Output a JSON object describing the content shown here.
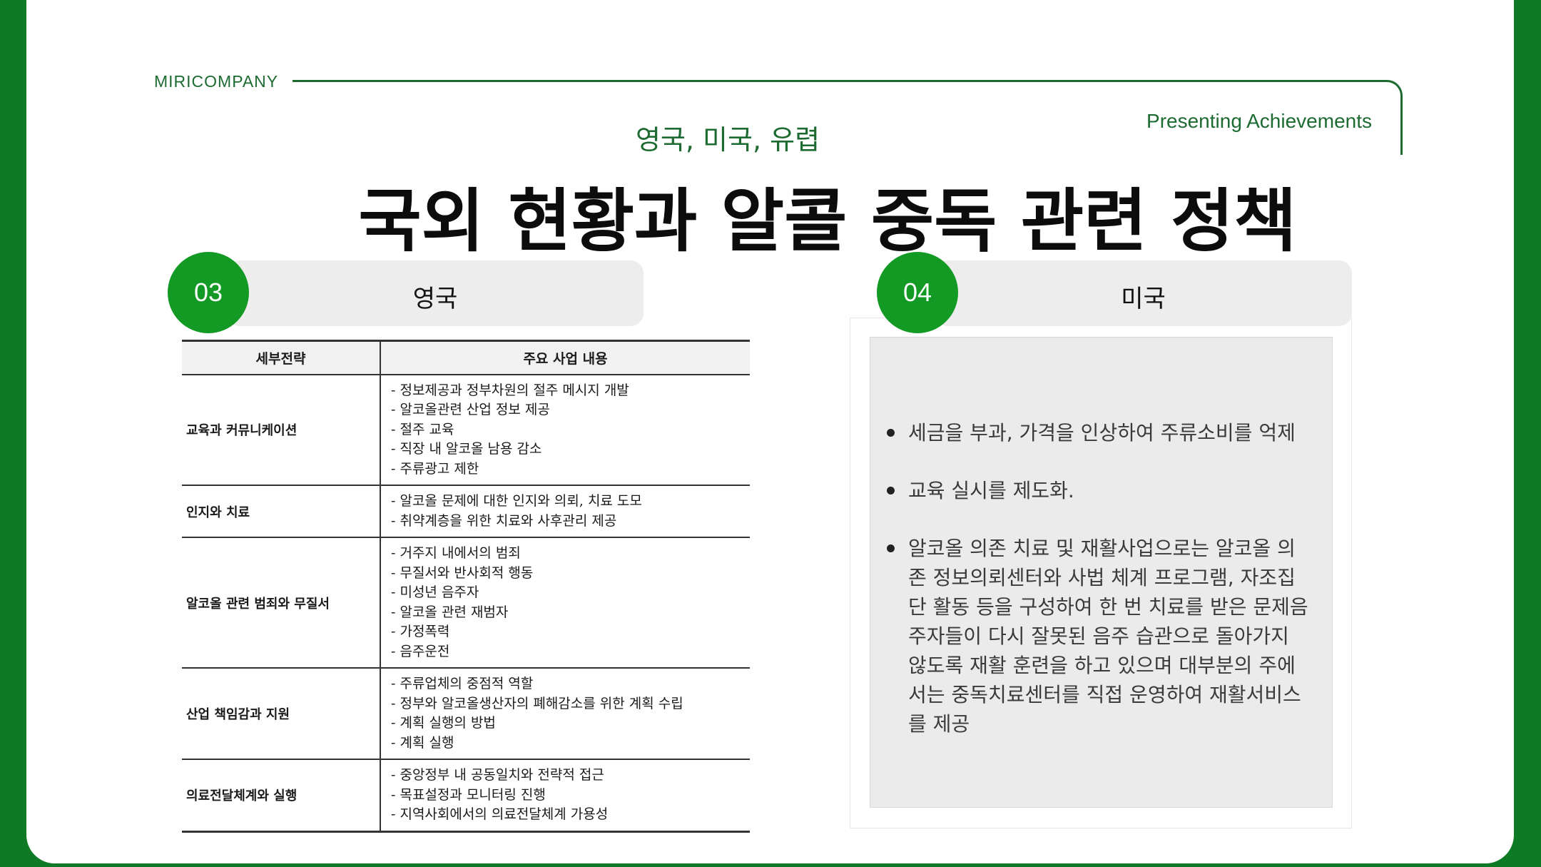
{
  "header": {
    "brand": "MIRICOMPANY",
    "tagline": "Presenting Achievements",
    "subtitle": "영국, 미국, 유렵",
    "title": "국외 현황과 알콜 중독 관련 정책"
  },
  "sections": {
    "uk": {
      "number": "03",
      "label": "영국"
    },
    "us": {
      "number": "04",
      "label": "미국"
    }
  },
  "uk_table": {
    "headers": [
      "세부전략",
      "주요 사업 내용"
    ],
    "rows": [
      {
        "strategy": "교육과 커뮤니케이션",
        "items": [
          "- 정보제공과 정부차원의 절주 메시지 개발",
          "- 알코올관련 산업 정보 제공",
          "- 절주 교육",
          "- 직장 내 알코올 남용 감소",
          "- 주류광고 제한"
        ]
      },
      {
        "strategy": "인지와 치료",
        "items": [
          "- 알코올 문제에 대한 인지와 의뢰, 치료 도모",
          "- 취약계층을 위한 치료와 사후관리 제공"
        ]
      },
      {
        "strategy": "알코올 관련 범죄와 무질서",
        "items": [
          "- 거주지 내에서의 범죄",
          "- 무질서와 반사회적 행동",
          "- 미성년 음주자",
          "- 알코올 관련 재범자",
          "- 가정폭력",
          "- 음주운전"
        ]
      },
      {
        "strategy": "산업 책임감과 지원",
        "items": [
          "- 주류업체의 중점적 역할",
          "- 정부와 알코올생산자의 폐해감소를 위한 계획 수립",
          "- 계획 실행의 방법",
          "- 계획 실행"
        ]
      },
      {
        "strategy": "의료전달체계와 실행",
        "items": [
          "- 중앙정부 내 공동일치와 전략적 접근",
          "- 목표설정과 모니터링 진행",
          "- 지역사회에서의 의료전달체계 가용성"
        ]
      }
    ]
  },
  "us_points": [
    [
      "세금을 부과, 가격을 인상하여 주류소비를 억제"
    ],
    [
      "교육 실시를 제도화."
    ],
    [
      "알코올 의존 치료 및 재활사업으로는 알코올 의",
      "존 정보의뢰센터와 사법 체계 프로그램, 자조집",
      "단 활동 등을 구성하여 한 번 치료를 받은 문제음",
      "주자들이 다시 잘못된 음주 습관으로 돌아가지",
      "않도록 재활 훈련을 하고 있으며 대부분의 주에",
      "서는 중독치료센터를 직접 운영하여 재활서비스",
      "를 제공"
    ]
  ],
  "colors": {
    "frame_green": "#0f7a25",
    "accent_green": "#139a24",
    "text_green": "#1e6b32"
  }
}
